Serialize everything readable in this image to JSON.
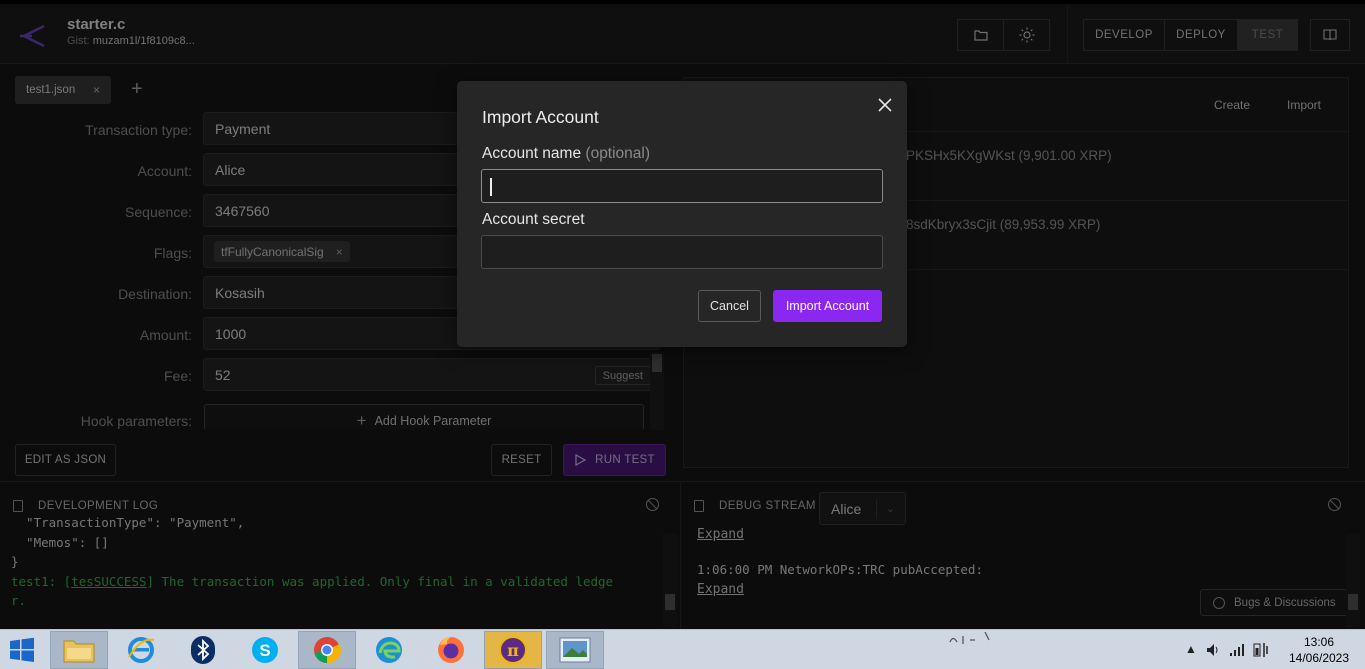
{
  "header": {
    "title": "starter.c",
    "gist_label": "Gist:",
    "gist_value": "muzam1l/1f8109c8...",
    "nav": {
      "develop": "DEVELOP",
      "deploy": "DEPLOY",
      "test": "TEST"
    }
  },
  "left": {
    "tab_label": "test1.json",
    "tab_close": "×",
    "add_tab": "+",
    "fields": [
      {
        "label": "Transaction type:",
        "value": "Payment"
      },
      {
        "label": "Account:",
        "value": "Alice"
      },
      {
        "label": "Sequence:",
        "value": "3467560"
      },
      {
        "label": "Flags:",
        "value": "tfFullyCanonicalSig"
      },
      {
        "label": "Destination:",
        "value": "Kosasih"
      },
      {
        "label": "Amount:",
        "value": "1000"
      },
      {
        "label": "Fee:",
        "value": "52"
      },
      {
        "label": "Hook parameters:",
        "value": "Add Hook Parameter"
      }
    ],
    "chip_close": "×",
    "suggest_label": "Suggest",
    "edit_json": "EDIT AS JSON",
    "reset": "RESET",
    "run_test": "RUN TEST"
  },
  "right": {
    "create": "Create",
    "import": "Import",
    "account1": "PKSHx5KXgWKst (9,901.00 XRP)",
    "account2": "8sdKbryx3sCjit (89,953.99 XRP)"
  },
  "devlog": {
    "title": "DEVELOPMENT LOG",
    "lines": [
      "  \"TransactionType\": \"Payment\",",
      "  \"Memos\": []",
      "}"
    ],
    "result_prefix": "test1: [",
    "result_code": "tesSUCCESS",
    "result_text": "] The transaction was applied. Only final in a validated ledge",
    "result_wrap": "r."
  },
  "debug": {
    "title": "DEBUG STREAM",
    "account": "Alice",
    "expand1": "Expand",
    "log_line": "1:06:00 PM NetworkOPs:TRC pubAccepted:",
    "expand2": "Expand",
    "bugs": "Bugs & Discussions"
  },
  "modal": {
    "title": "Import Account",
    "name_label": "Account name",
    "name_optional": "(optional)",
    "name_value": "",
    "secret_label": "Account secret",
    "secret_value": "",
    "cancel": "Cancel",
    "submit": "Import Account"
  },
  "taskbar": {
    "time": "13:06",
    "date": "14/06/2023"
  },
  "colors": {
    "accent": "#8a27f0",
    "success": "#3fb950",
    "background": "#161616"
  }
}
